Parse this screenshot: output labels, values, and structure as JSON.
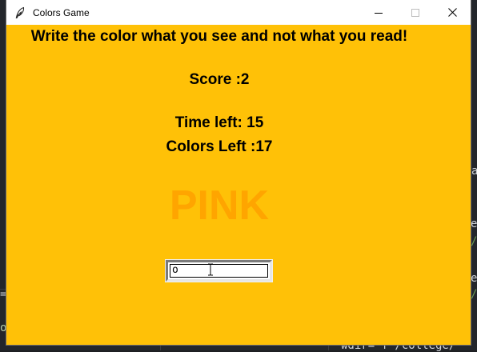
{
  "window": {
    "title": "Colors Game"
  },
  "game": {
    "instructions": "Write the color what you see and not what you read!",
    "score": "Score :2",
    "time_left": "Time left: 15",
    "colors_left": "Colors Left :17",
    "color_word": "PINK",
    "color_word_color": "#ffa500",
    "background_color": "#ffc107"
  },
  "entry": {
    "value": "o"
  },
  "background_editor": {
    "fragments": [
      "a",
      "e",
      "/",
      "e",
      "/",
      "=",
      "or",
      "wdir= f'/college/"
    ]
  },
  "icons": [
    "feather-icon",
    "minimize-icon",
    "maximize-icon",
    "close-icon",
    "text-cursor-icon"
  ]
}
